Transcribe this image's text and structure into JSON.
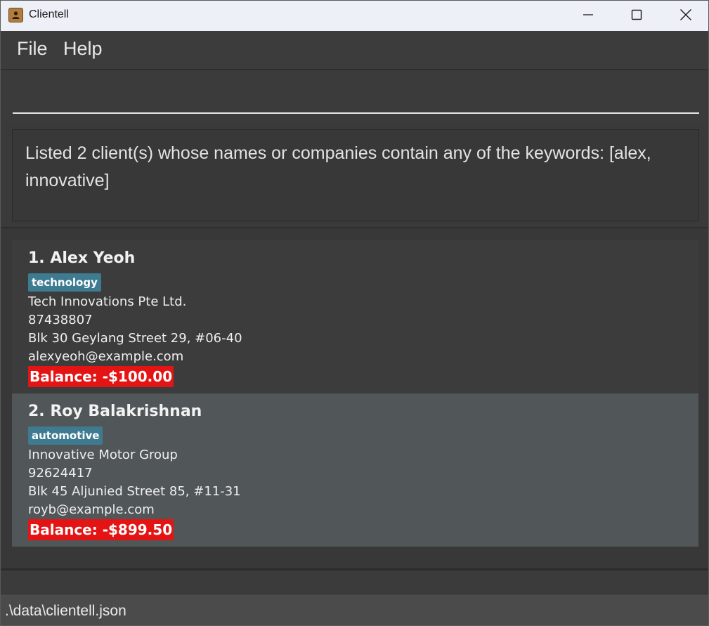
{
  "window": {
    "title": "Clientell",
    "app_icon": "contact-book-icon",
    "controls": [
      "minimize-icon",
      "maximize-icon",
      "close-icon"
    ]
  },
  "menu": {
    "items": [
      {
        "label": "File"
      },
      {
        "label": "Help"
      }
    ]
  },
  "command": {
    "value": "",
    "placeholder": ""
  },
  "result": {
    "message": "Listed 2 client(s) whose names or companies contain any of the keywords: [alex, innovative]"
  },
  "clients": [
    {
      "name": "1. Alex Yeoh",
      "tag": "technology",
      "company": "Tech Innovations Pte Ltd.",
      "phone": "87438807",
      "address": "Blk 30 Geylang Street 29, #06-40",
      "email": "alexyeoh@example.com",
      "balance": "Balance: -$100.00"
    },
    {
      "name": "2. Roy Balakrishnan",
      "tag": "automotive",
      "company": "Innovative Motor Group",
      "phone": "92624417",
      "address": "Blk 45 Aljunied Street 85, #11-31",
      "email": "royb@example.com",
      "balance": "Balance: -$899.50"
    }
  ],
  "status": {
    "file_path": ".\\data\\clientell.json"
  },
  "colors": {
    "tag_background": "#3e7b91",
    "negative_balance": "#e41414",
    "selected_card": "#515658"
  }
}
